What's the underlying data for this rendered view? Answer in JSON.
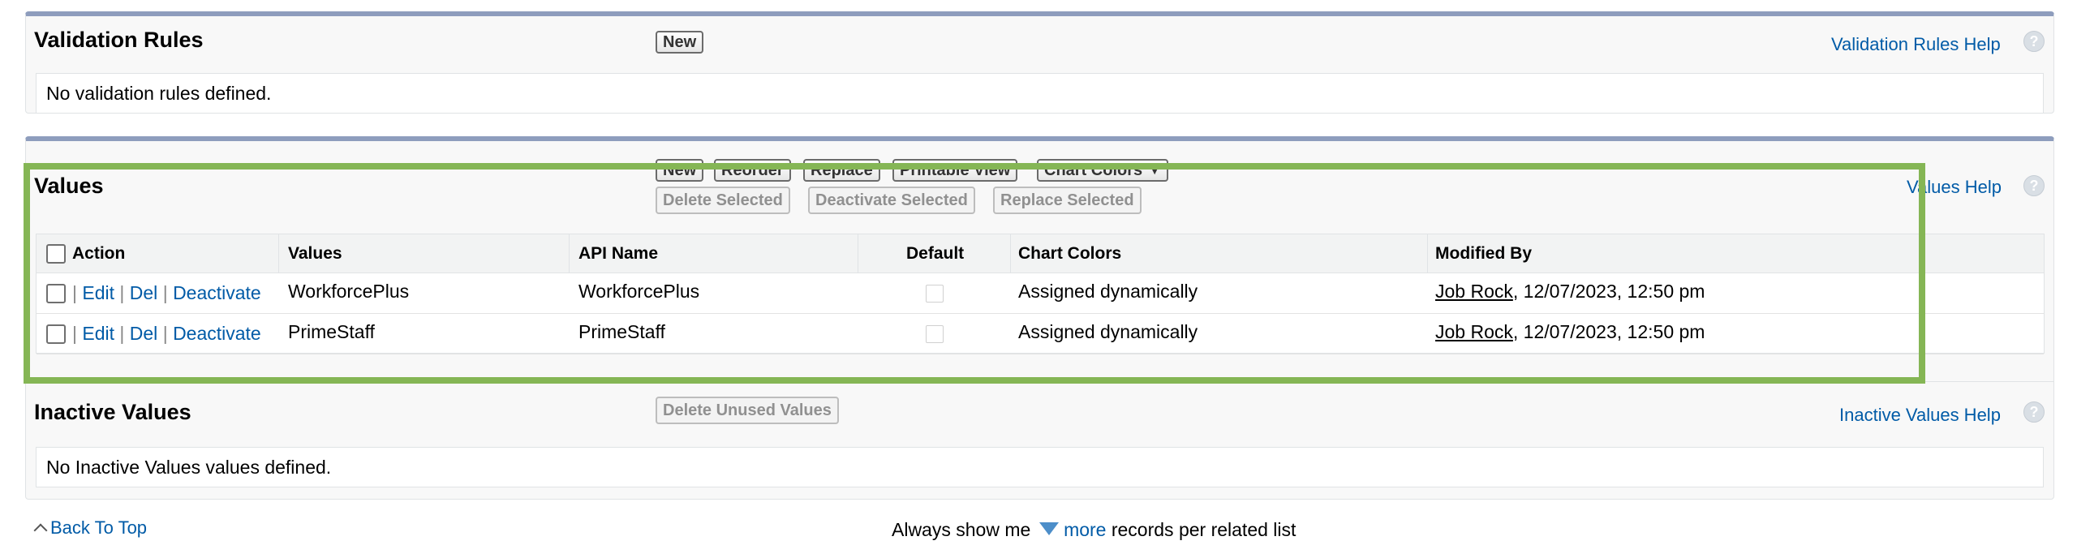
{
  "validation_rules": {
    "title": "Validation Rules",
    "new_label": "New",
    "help_label": "Validation Rules Help",
    "empty_text": "No validation rules defined."
  },
  "values_section": {
    "title": "Values",
    "help_label": "Values Help",
    "buttons": {
      "new": "New",
      "reorder": "Reorder",
      "replace": "Replace",
      "printable_view": "Printable View",
      "chart_colors": "Chart Colors",
      "delete_selected": "Delete Selected",
      "deactivate_selected": "Deactivate Selected",
      "replace_selected": "Replace Selected"
    },
    "columns": [
      "Action",
      "Values",
      "API Name",
      "Default",
      "Chart Colors",
      "Modified By"
    ],
    "action_links": {
      "edit": "Edit",
      "del": "Del",
      "deactivate": "Deactivate",
      "separator": "|"
    },
    "rows": [
      {
        "value": "WorkforcePlus",
        "api_name": "WorkforcePlus",
        "default": false,
        "chart_colors": "Assigned dynamically",
        "modified_by": "Job Rock",
        "modified_on": ", 12/07/2023, 12:50 pm"
      },
      {
        "value": "PrimeStaff",
        "api_name": "PrimeStaff",
        "default": false,
        "chart_colors": "Assigned dynamically",
        "modified_by": "Job Rock",
        "modified_on": ", 12/07/2023, 12:50 pm"
      }
    ]
  },
  "inactive_values": {
    "title": "Inactive Values",
    "delete_unused_label": "Delete Unused Values",
    "help_label": "Inactive Values Help",
    "empty_text": "No Inactive Values values defined."
  },
  "footer": {
    "back_to_top": "Back To Top",
    "always_show": "Always show me",
    "more": "more",
    "records_text": "records per related list"
  },
  "colors": {
    "link": "#015ba7",
    "section_border": "#8e9dbd",
    "highlight": "#85b655"
  },
  "icons": {
    "help": "help-icon",
    "dropdown": "chevron-down-icon",
    "more": "triangle-down-icon",
    "back_to_top": "caret-up-icon"
  }
}
